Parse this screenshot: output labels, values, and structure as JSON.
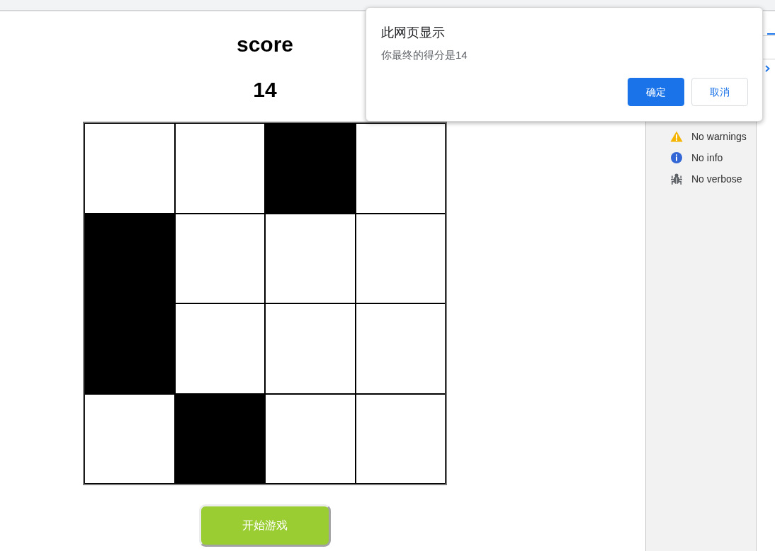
{
  "game": {
    "title": "score",
    "score": "14",
    "tiles": [
      [
        {
          "black": false
        },
        {
          "black": false
        },
        {
          "black": true
        },
        {
          "black": false
        }
      ],
      [
        {
          "black": true
        },
        {
          "black": false
        },
        {
          "black": false
        },
        {
          "black": false
        }
      ],
      [
        {
          "black": true
        },
        {
          "black": false
        },
        {
          "black": false
        },
        {
          "black": false
        }
      ],
      [
        {
          "black": false
        },
        {
          "black": true
        },
        {
          "black": false
        },
        {
          "black": false
        }
      ]
    ],
    "start_button": "开始游戏"
  },
  "console_sidebar": {
    "items": [
      {
        "kind": "warning",
        "label": "No warnings"
      },
      {
        "kind": "info",
        "label": "No info"
      },
      {
        "kind": "verbose",
        "label": "No verbose"
      }
    ]
  },
  "dialog": {
    "title": "此网页显示",
    "message": "你最终的得分是14",
    "buttons": [
      {
        "label": "确定",
        "primary": true
      },
      {
        "label": "取消",
        "primary": false
      }
    ]
  }
}
